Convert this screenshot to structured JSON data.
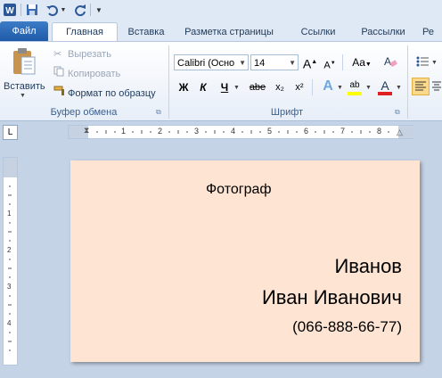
{
  "quick_access": {
    "app_icon": "word-icon",
    "save_icon": "save-icon",
    "undo_icon": "undo-icon",
    "redo_icon": "redo-icon",
    "customize_icon": "customize-qat-icon"
  },
  "tabs": {
    "file": "Файл",
    "home": "Главная",
    "insert": "Вставка",
    "layout": "Разметка страницы",
    "references": "Ссылки",
    "mailings": "Рассылки",
    "review": "Ре"
  },
  "clipboard": {
    "paste_label": "Вставить",
    "cut_label": "Вырезать",
    "copy_label": "Копировать",
    "format_painter_label": "Формат по образцу",
    "group_label": "Буфер обмена"
  },
  "font": {
    "font_name": "Calibri (Осно",
    "font_size": "14",
    "group_label": "Шрифт",
    "grow_label": "A",
    "shrink_label": "A",
    "case_label": "Aa",
    "bold": "Ж",
    "italic": "К",
    "underline": "Ч",
    "strike": "abe",
    "subscript": "x₂",
    "superscript": "x²",
    "text_effects": "A",
    "highlight": "ab",
    "font_color": "A",
    "highlight_color": "#ffff00",
    "font_color_value": "#e02020"
  },
  "ruler": {
    "ticks": [
      "1",
      "2",
      "3",
      "4",
      "5",
      "6",
      "7",
      "8"
    ],
    "vticks": [
      "1",
      "2",
      "3",
      "4"
    ],
    "tab_selector": "L"
  },
  "document": {
    "page_color": "#fde4d3",
    "line1": "Фотограф",
    "line2": "Иванов",
    "line3": "Иван Иванович",
    "line4": "(066-888-66-77)"
  }
}
